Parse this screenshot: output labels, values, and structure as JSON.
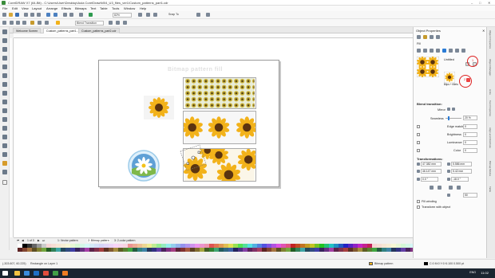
{
  "app": {
    "title": "CorelDRAW X7 (64-Bit) - C:\\Users\\User\\Desktop\\Aula CorelDraw\\M04_U3_files_ver1\\Custom_patterns_part1.cdr"
  },
  "menu": [
    "File",
    "Edit",
    "View",
    "Layout",
    "Arrange",
    "Effects",
    "Bitmaps",
    "Text",
    "Table",
    "Tools",
    "Window",
    "Help"
  ],
  "toolbar": {
    "zoom": "82%",
    "snap_to": "Snap To",
    "blend_transition": "Blend Transition"
  },
  "doc_tabs": [
    "Welcome Screen",
    "Custom_patterns_part1...",
    "Custom_patterns_part2.cdr"
  ],
  "canvas": {
    "watermark": "Bitmap pattern fill"
  },
  "page_nav": {
    "counter": "1 of 3",
    "tabs": [
      "1: Vector pattern",
      "2: Bitmap pattern",
      "3: 2-color pattern"
    ]
  },
  "docker": {
    "title": "Object Properties",
    "fill_label": "Fill",
    "pattern_name_1": "Untitled",
    "pattern_name_2": "Blips + fillets",
    "blend_transition_title": "Blend transition:",
    "mirror_label": "Mirror",
    "seamless_label": "Seamless",
    "seamless_value": "20 %",
    "edge_match_label": "Edge match",
    "edge_match_value": "0",
    "brightness_label": "Brightness",
    "brightness_value": "0",
    "luminance_label": "Luminance",
    "luminance_value": "0",
    "color_label": "Color",
    "color_value": "0",
    "transformations_title": "Transformations:",
    "w_value": "47.382 mm",
    "h_value": "46.147 mm",
    "x_value": "5.586 mm",
    "y_value": "5.42 mm",
    "angle_value": "0.0 °",
    "skew_value": "-18.0 °",
    "row_value": "50",
    "fill_winding": "Fill winding",
    "transform_with_object": "Transform with object",
    "callout_1": "1",
    "callout_2": "2"
  },
  "docker_tabs": [
    "Object Properties",
    "Object Manager",
    "Hints",
    "Text Properties",
    "Align and Distribute",
    "Bitmap Modes",
    "Table"
  ],
  "status": {
    "coords": "(-303.607, 60.225)",
    "object_info": "Rectangle on Layer 1",
    "fill_info": "Bitmap pattern",
    "color_info": "C:0 M:0 Y:0 K:100  0.500 pt"
  },
  "taskbar": {
    "language": "ENG",
    "time": "11:02"
  },
  "colors": {
    "sunflower_petal": "#f2b21a",
    "sunflower_center": "#5b3410",
    "accent_blue": "#2a7bd5",
    "callout_red": "#d22222"
  }
}
